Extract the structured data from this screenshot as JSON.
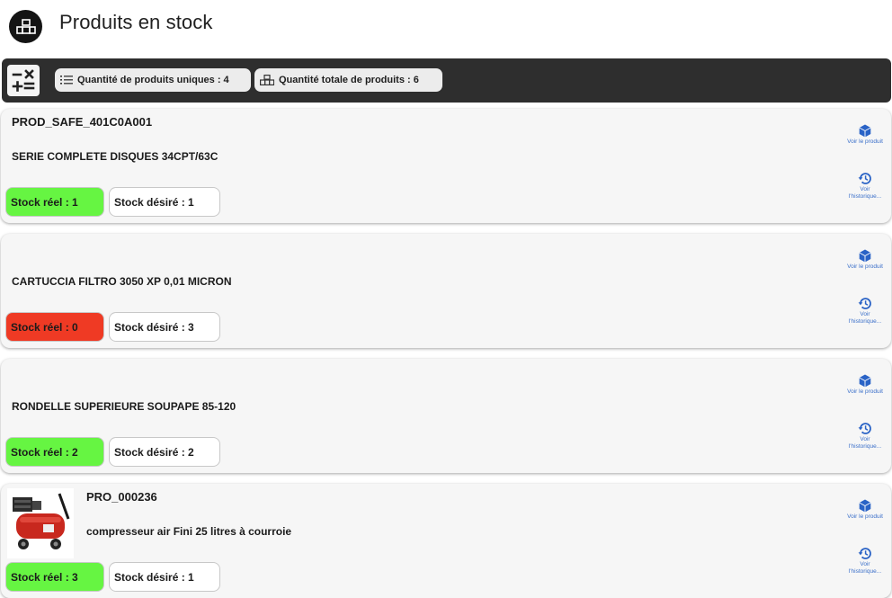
{
  "header": {
    "title": "Produits en stock"
  },
  "toolbar": {
    "unique_label": "Quantité de produits uniques : 4",
    "total_label": "Quantité totale de produits : 6"
  },
  "colors": {
    "stock_ok": "#66f542",
    "stock_empty": "#ef3a24",
    "action_blue": "#2a63c6",
    "toolbar_bg": "#2e2e2e"
  },
  "actions": {
    "view_product": "Voir le produit",
    "view_history": "Voir l'historique..."
  },
  "products": [
    {
      "code": "PROD_SAFE_401C0A001",
      "name": "SERIE COMPLETE DISQUES 34CPT/63C",
      "stock_real": "Stock réel : 1",
      "stock_wanted": "Stock désiré : 1",
      "status": "ok"
    },
    {
      "code": "",
      "name": "CARTUCCIA FILTRO 3050 XP 0,01 MICRON",
      "stock_real": "Stock réel : 0",
      "stock_wanted": "Stock désiré : 3",
      "status": "empty"
    },
    {
      "code": "",
      "name": "RONDELLE SUPERIEURE SOUPAPE 85-120",
      "stock_real": "Stock réel : 2",
      "stock_wanted": "Stock désiré : 2",
      "status": "ok"
    },
    {
      "code": "PRO_000236",
      "name": "compresseur air Fini 25 litres à courroie",
      "stock_real": "Stock réel : 3",
      "stock_wanted": "Stock désiré : 1",
      "status": "ok",
      "image": "compressor-image"
    }
  ]
}
